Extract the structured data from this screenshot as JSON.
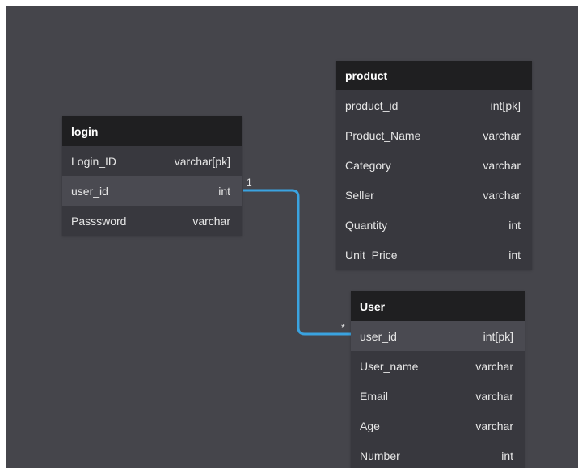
{
  "tables": {
    "login": {
      "name": "login",
      "columns": [
        {
          "name": "Login_ID",
          "type": "varchar[pk]"
        },
        {
          "name": "user_id",
          "type": "int"
        },
        {
          "name": "Passsword",
          "type": "varchar"
        }
      ]
    },
    "product": {
      "name": "product",
      "columns": [
        {
          "name": "product_id",
          "type": "int[pk]"
        },
        {
          "name": "Product_Name",
          "type": "varchar"
        },
        {
          "name": "Category",
          "type": "varchar"
        },
        {
          "name": "Seller",
          "type": "varchar"
        },
        {
          "name": "Quantity",
          "type": "int"
        },
        {
          "name": "Unit_Price",
          "type": "int"
        }
      ]
    },
    "user": {
      "name": "User",
      "columns": [
        {
          "name": "user_id",
          "type": "int[pk]"
        },
        {
          "name": "User_name",
          "type": "varchar"
        },
        {
          "name": "Email",
          "type": "varchar"
        },
        {
          "name": "Age",
          "type": "varchar"
        },
        {
          "name": "Number",
          "type": "int"
        }
      ]
    }
  },
  "relationship": {
    "from": "login.user_id",
    "to": "User.user_id",
    "from_cardinality": "1",
    "to_cardinality": "*",
    "color": "#3aa3e0"
  },
  "colors": {
    "canvas": "#45454b",
    "table_header": "#1f1f21",
    "table_body": "#38383e",
    "row_highlight": "#4a4a51"
  }
}
